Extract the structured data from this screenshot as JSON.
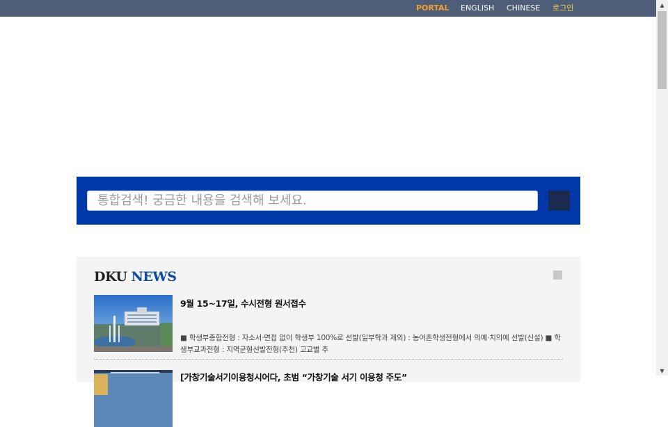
{
  "top_nav": {
    "portal": "PORTAL",
    "english": "ENGLISH",
    "chinese": "CHINESE",
    "login": "로그인"
  },
  "search": {
    "placeholder": "통합검색! 궁금한 내용을 검색해 보세요."
  },
  "news": {
    "title_part1": "DKU",
    "title_part2": "NEWS",
    "items": [
      {
        "headline": "9월 15~17일, 수시전형 원서접수",
        "summary": "■ 학생부종합전형 : 자소서·면접 없이 학생부 100%로 선발(일부학과 제외) : 농어촌학생전형에서 의예·치의예 선발(신설) ■ 학생부교과전형 : 지역균형선발전형(추천) 고교별 추"
      },
      {
        "headline": "[가창기술서기이용청시어다, 초범 “가창기술 서기 이용청 주도”"
      }
    ]
  },
  "colors": {
    "top_bar": "#4e5d78",
    "portal_link": "#f7a12c",
    "login_link": "#f2d24b",
    "search_band": "#0038a8",
    "news_accent": "#0b4aa3"
  },
  "icons": {
    "search_button": "search-icon",
    "more_button": "more-icon",
    "scroll_up": "scroll-up-arrow-icon",
    "scroll_down": "scroll-down-arrow-icon"
  }
}
